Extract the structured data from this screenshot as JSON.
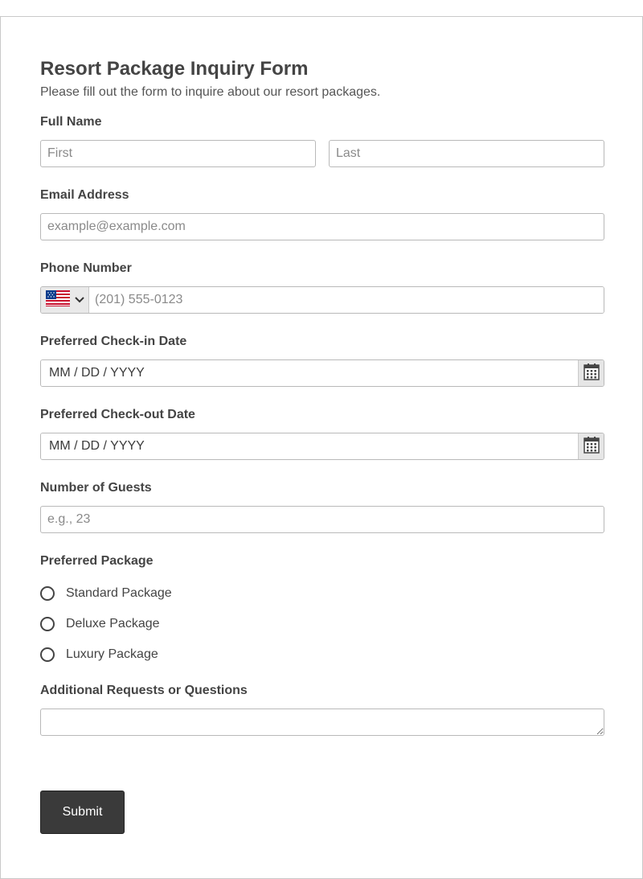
{
  "form": {
    "title": "Resort Package Inquiry Form",
    "subtitle": "Please fill out the form to inquire about our resort packages."
  },
  "full_name": {
    "label": "Full Name",
    "first_placeholder": "First",
    "last_placeholder": "Last"
  },
  "email": {
    "label": "Email Address",
    "placeholder": "example@example.com"
  },
  "phone": {
    "label": "Phone Number",
    "country_flag": "us-flag-icon",
    "placeholder": "(201) 555-0123"
  },
  "checkin": {
    "label": "Preferred Check-in Date",
    "placeholder": "MM / DD / YYYY"
  },
  "checkout": {
    "label": "Preferred Check-out Date",
    "placeholder": "MM / DD / YYYY"
  },
  "guests": {
    "label": "Number of Guests",
    "placeholder": "e.g., 23"
  },
  "package": {
    "label": "Preferred Package",
    "options": [
      "Standard Package",
      "Deluxe Package",
      "Luxury Package"
    ]
  },
  "requests": {
    "label": "Additional Requests or Questions"
  },
  "submit": {
    "label": "Submit"
  },
  "colors": {
    "submit_bg": "#3a3a3a",
    "border": "#b9b9b9",
    "text": "#444444"
  }
}
